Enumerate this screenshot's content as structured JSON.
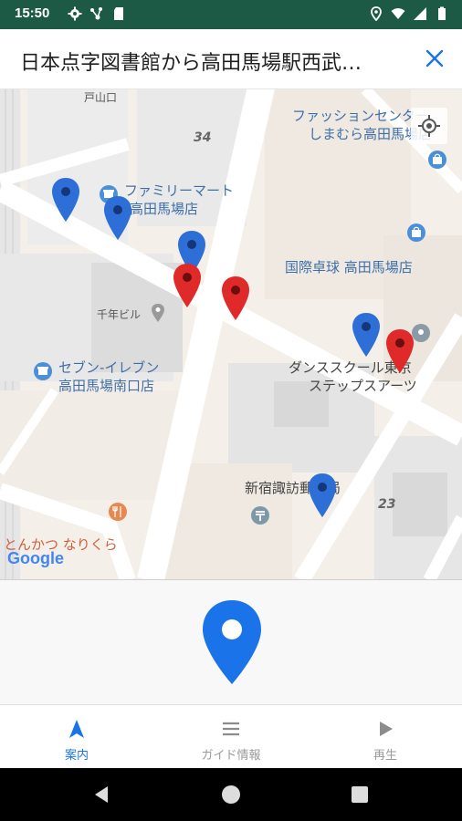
{
  "status_bar": {
    "time": "15:50",
    "left_icons": [
      "gear-icon",
      "network-icon",
      "sd-card-icon"
    ],
    "right_icons": [
      "location-icon",
      "wifi-icon",
      "signal-icon",
      "battery-icon"
    ]
  },
  "header": {
    "title": "日本点字図書館から高田馬場駅西武…",
    "close_icon": "close-icon"
  },
  "map": {
    "labels": {
      "toyamaguchi": "戸山口",
      "block34": "34",
      "fashion_center_1": "ファッションセンター",
      "fashion_center_2": "しまむら高田馬場店",
      "familymart_1": "ファミリーマート",
      "familymart_2": "高田馬場店",
      "kokusai_takkyu": "国際卓球 高田馬場店",
      "sennen_bldg": "千年ビル",
      "seven_eleven_1": "セブン-イレブン",
      "seven_eleven_2": "高田馬場南口店",
      "dance_school_1": "ダンススクール東京",
      "dance_school_2": "ステップスアーツ",
      "post_office": "新宿諏訪郵便局",
      "block23": "23",
      "tonkatsu": "とんかつ なりくら",
      "google": "Google"
    },
    "colors": {
      "blue_pin": "#2d6fd6",
      "red_pin": "#e02a2a",
      "poi_blue": "#4a90d9"
    }
  },
  "bottom_nav": {
    "items": [
      {
        "label": "案内",
        "icon": "navigation-arrow-icon",
        "active": true
      },
      {
        "label": "ガイド情報",
        "icon": "menu-icon",
        "active": false
      },
      {
        "label": "再生",
        "icon": "play-icon",
        "active": false
      }
    ]
  },
  "accent_color": "#1a73e8"
}
